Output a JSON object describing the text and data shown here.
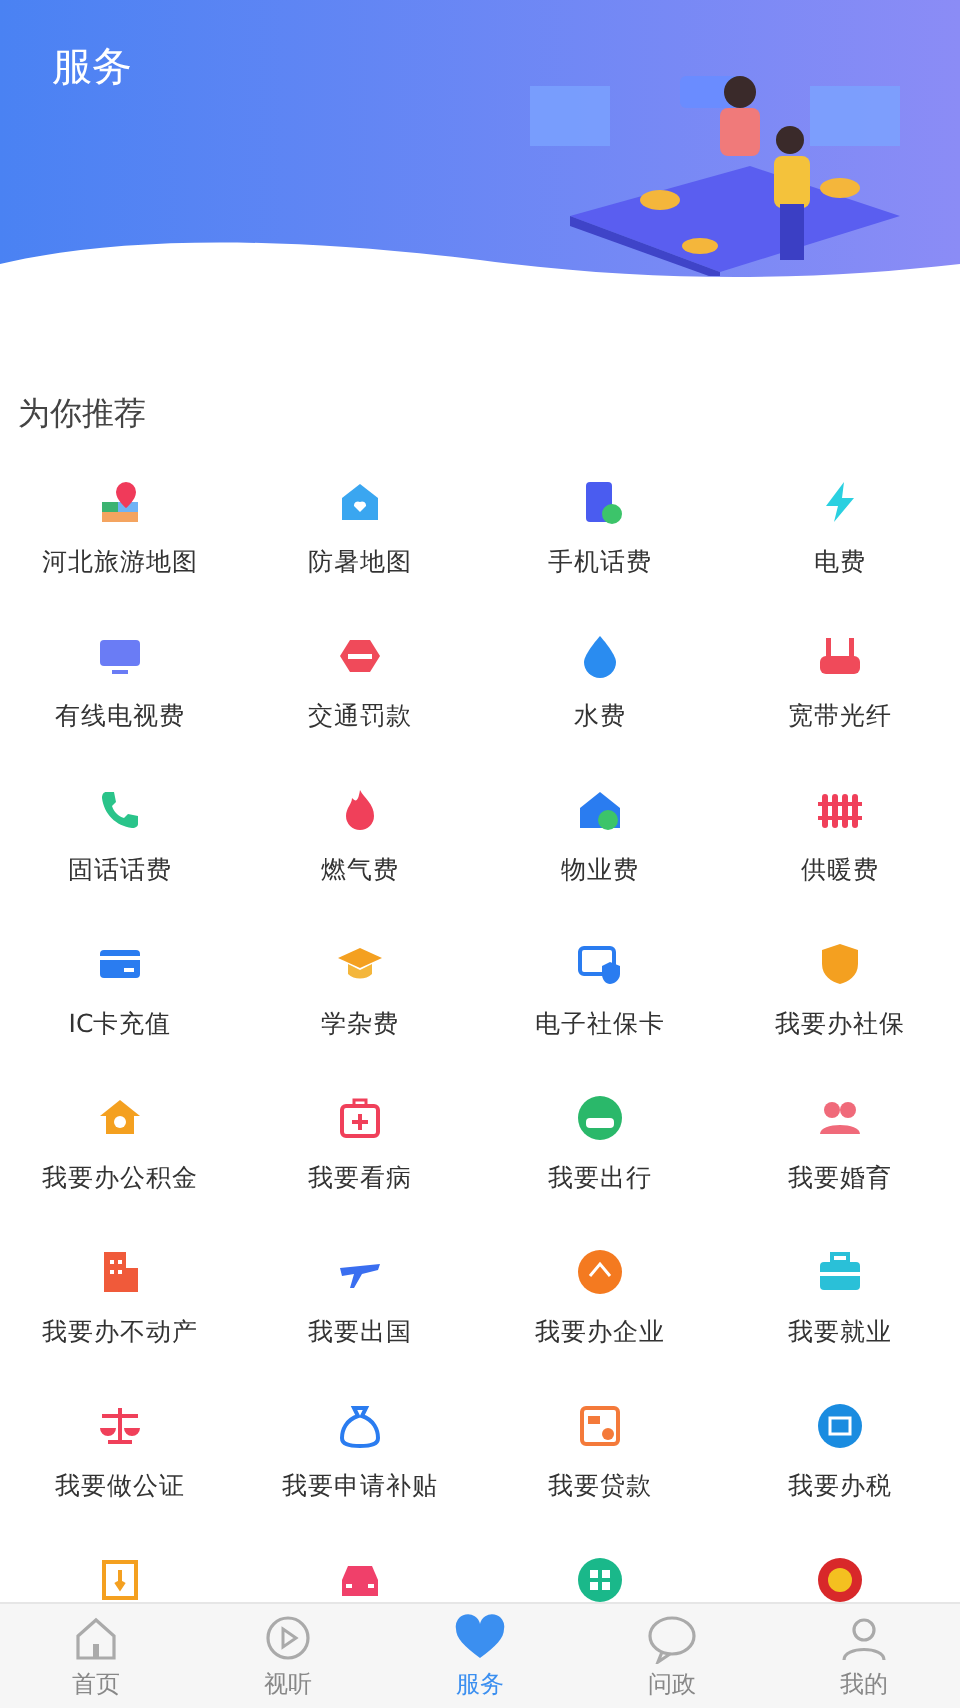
{
  "header": {
    "title": "服务"
  },
  "section": {
    "title": "为你推荐"
  },
  "services": [
    {
      "kind": "labeled",
      "label": "河北旅游地图"
    },
    {
      "kind": "labeled",
      "label": "防暑地图"
    },
    {
      "kind": "labeled",
      "label": "手机话费"
    },
    {
      "kind": "labeled",
      "label": "电费"
    },
    {
      "kind": "labeled",
      "label": "有线电视费"
    },
    {
      "kind": "labeled",
      "label": "交通罚款"
    },
    {
      "kind": "labeled",
      "label": "水费"
    },
    {
      "kind": "labeled",
      "label": "宽带光纤"
    },
    {
      "kind": "labeled",
      "label": "固话话费"
    },
    {
      "kind": "labeled",
      "label": "燃气费"
    },
    {
      "kind": "labeled",
      "label": "物业费"
    },
    {
      "kind": "labeled",
      "label": "供暖费"
    },
    {
      "kind": "labeled",
      "label": "IC卡充值"
    },
    {
      "kind": "labeled",
      "label": "学杂费"
    },
    {
      "kind": "labeled",
      "label": "电子社保卡"
    },
    {
      "kind": "labeled",
      "label": "我要办社保"
    },
    {
      "kind": "labeled",
      "label": "我要办公积金"
    },
    {
      "kind": "labeled",
      "label": "我要看病"
    },
    {
      "kind": "labeled",
      "label": "我要出行"
    },
    {
      "kind": "labeled",
      "label": "我要婚育"
    },
    {
      "kind": "labeled",
      "label": "我要办不动产"
    },
    {
      "kind": "labeled",
      "label": "我要出国"
    },
    {
      "kind": "labeled",
      "label": "我要办企业"
    },
    {
      "kind": "labeled",
      "label": "我要就业"
    },
    {
      "kind": "labeled",
      "label": "我要做公证"
    },
    {
      "kind": "labeled",
      "label": "我要申请补贴"
    },
    {
      "kind": "labeled",
      "label": "我要贷款"
    },
    {
      "kind": "labeled",
      "label": "我要办税"
    },
    {
      "kind": "icon_only"
    },
    {
      "kind": "icon_only"
    },
    {
      "kind": "icon_only"
    },
    {
      "kind": "icon_only"
    }
  ],
  "tab_bar": [
    {
      "label": "首页",
      "selected": false
    },
    {
      "label": "视听",
      "selected": false
    },
    {
      "label": "服务",
      "selected": true
    },
    {
      "label": "问政",
      "selected": false
    },
    {
      "label": "我的",
      "selected": false
    }
  ]
}
